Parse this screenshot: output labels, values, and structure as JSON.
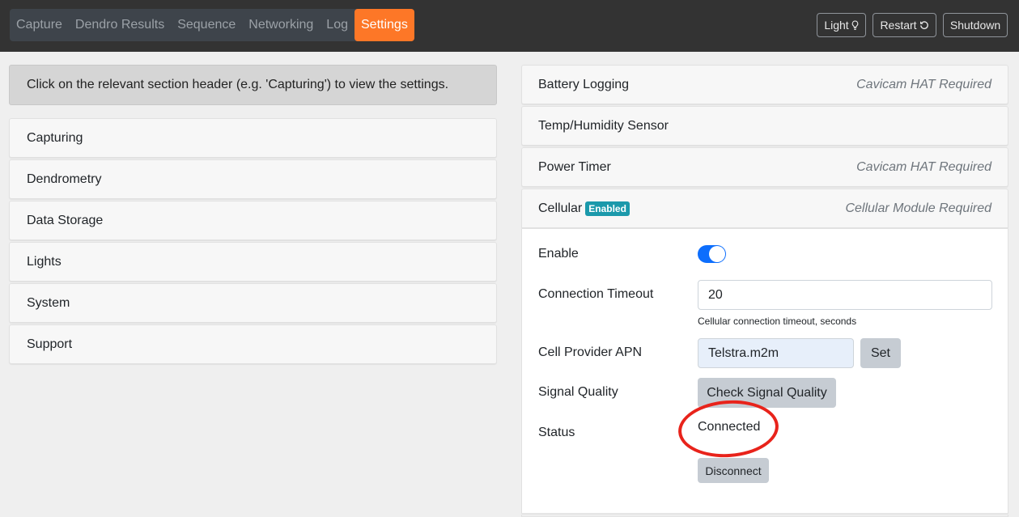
{
  "nav": {
    "items": [
      {
        "label": "Capture",
        "active": false
      },
      {
        "label": "Dendro Results",
        "active": false
      },
      {
        "label": "Sequence",
        "active": false
      },
      {
        "label": "Networking",
        "active": false
      },
      {
        "label": "Log",
        "active": false
      },
      {
        "label": "Settings",
        "active": true
      }
    ],
    "accent_color": "#fd7727"
  },
  "top_buttons": {
    "light": {
      "label": "Light",
      "icon": "lightbulb-icon"
    },
    "restart": {
      "label": "Restart",
      "icon": "restart-icon"
    },
    "shutdown": {
      "label": "Shutdown"
    }
  },
  "left": {
    "info": "Click on the relevant section header (e.g. 'Capturing') to view the settings.",
    "sections": [
      "Capturing",
      "Dendrometry",
      "Data Storage",
      "Lights",
      "System",
      "Support"
    ]
  },
  "right": {
    "sections": [
      {
        "title": "Battery Logging",
        "requirement": "Cavicam HAT Required"
      },
      {
        "title": "Temp/Humidity Sensor",
        "requirement": ""
      },
      {
        "title": "Power Timer",
        "requirement": "Cavicam HAT Required"
      },
      {
        "title": "Cellular",
        "badge": "Enabled",
        "requirement": "Cellular Module Required"
      }
    ],
    "cellular": {
      "enable_label": "Enable",
      "enabled": true,
      "timeout_label": "Connection Timeout",
      "timeout_value": "20",
      "timeout_help": "Cellular connection timeout, seconds",
      "apn_label": "Cell Provider APN",
      "apn_value": "Telstra.m2m",
      "set_label": "Set",
      "signal_label": "Signal Quality",
      "signal_button": "Check Signal Quality",
      "status_label": "Status",
      "status_value": "Connected",
      "disconnect_label": "Disconnect"
    }
  }
}
